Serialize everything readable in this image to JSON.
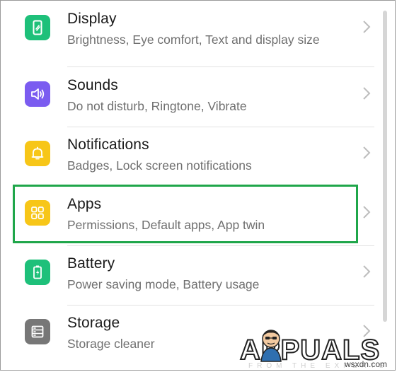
{
  "settings": {
    "items": [
      {
        "title": "Display",
        "subtitle": "Brightness, Eye comfort, Text and display size",
        "icon": "display-icon",
        "color": "#1ec07a"
      },
      {
        "title": "Sounds",
        "subtitle": "Do not disturb, Ringtone, Vibrate",
        "icon": "speaker-icon",
        "color": "#7b5cf0"
      },
      {
        "title": "Notifications",
        "subtitle": "Badges, Lock screen notifications",
        "icon": "bell-icon",
        "color": "#f7c618"
      },
      {
        "title": "Apps",
        "subtitle": "Permissions, Default apps, App twin",
        "icon": "apps-grid-icon",
        "color": "#f7c618"
      },
      {
        "title": "Battery",
        "subtitle": "Power saving mode, Battery usage",
        "icon": "battery-icon",
        "color": "#1ec07a"
      },
      {
        "title": "Storage",
        "subtitle": "Storage cleaner",
        "icon": "storage-icon",
        "color": "#777777"
      }
    ],
    "highlighted_item": "Apps",
    "highlight_color": "#1fa64a"
  },
  "watermark": {
    "brand": "APPUALS",
    "tagline": "FROM THE EXPERTS"
  },
  "site_label": "wsxdn.com"
}
